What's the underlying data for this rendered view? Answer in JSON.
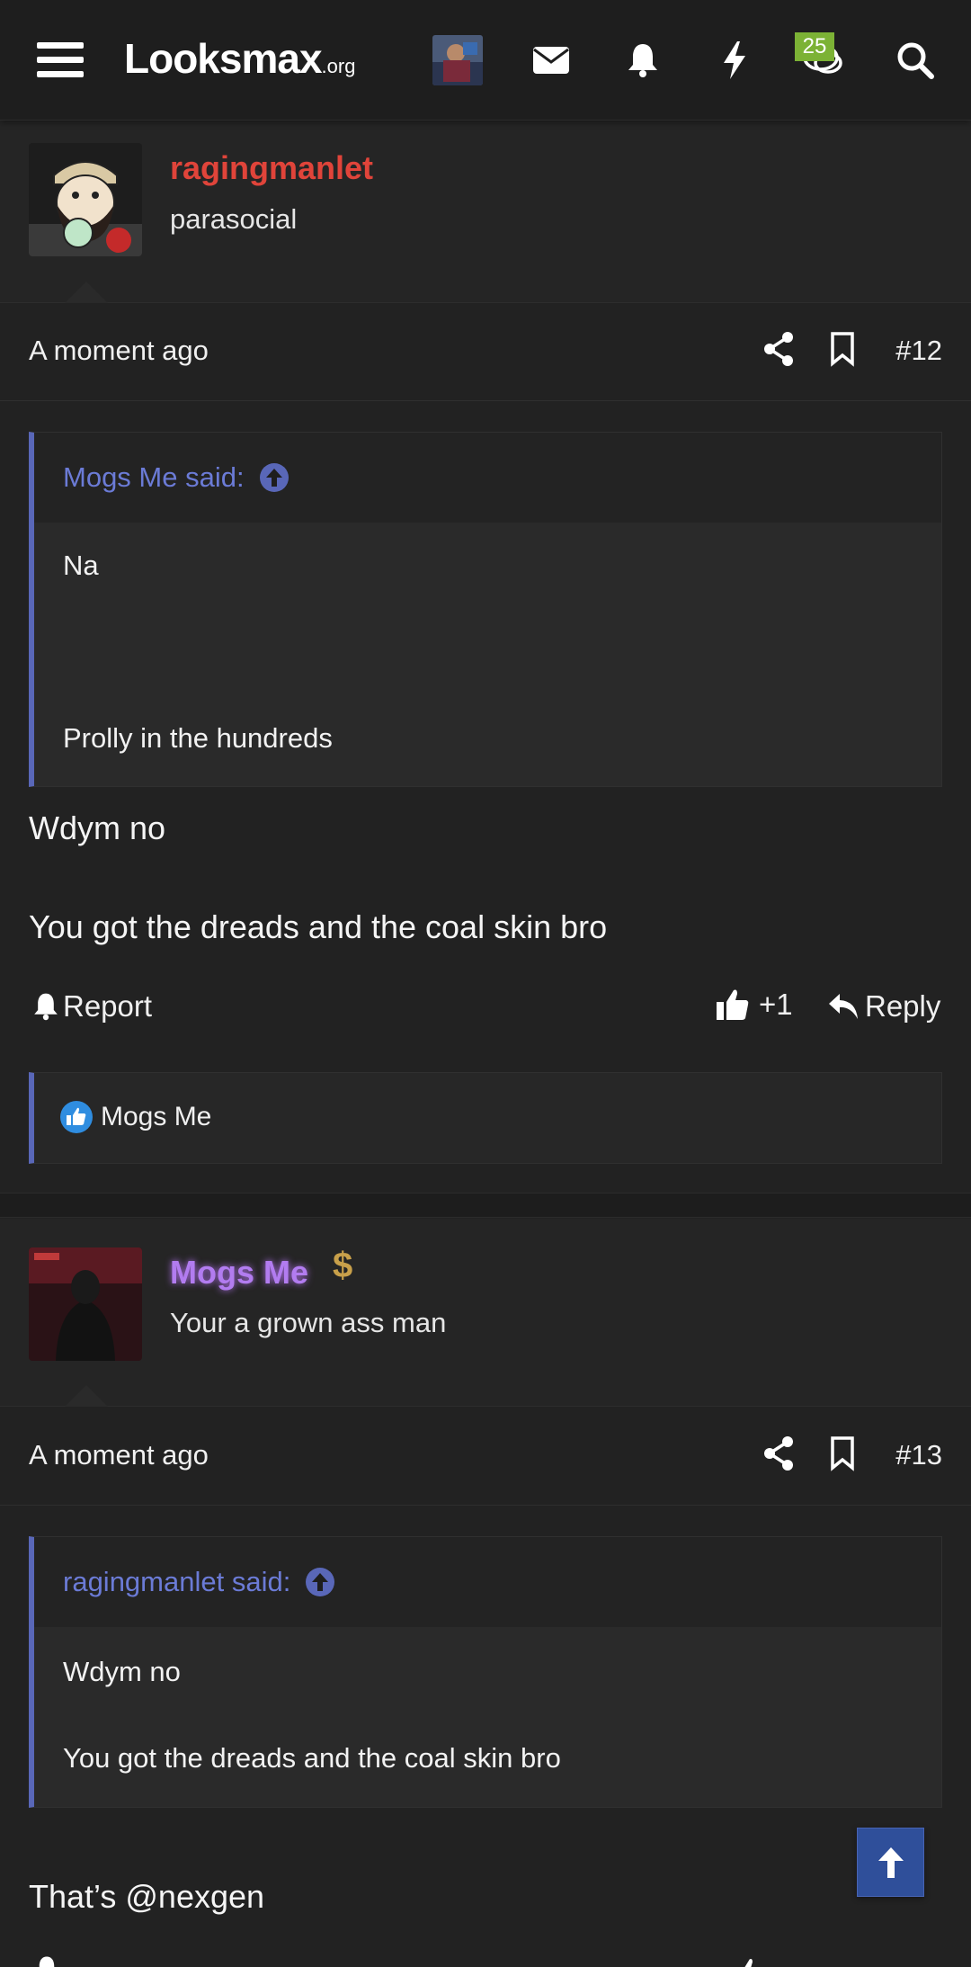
{
  "header": {
    "logo_main": "Loοksmax",
    "logo_suffix": ".org",
    "conversations_badge": "25",
    "icons": [
      "menu-icon",
      "avatar",
      "mail-icon",
      "bell-icon",
      "bolt-icon",
      "chat-icon",
      "search-icon"
    ]
  },
  "posts": [
    {
      "username": "ragingmanlet",
      "username_color": "#e0443a",
      "user_title": "parasocial",
      "time": "A moment ago",
      "number": "#12",
      "quote": {
        "attribution": "Mogs Me said:",
        "lines": [
          "Na",
          "Prolly in the hundreds"
        ]
      },
      "message": [
        "Wdym no",
        "You got the dreads and the coal skin bro"
      ],
      "actions": {
        "report": "Report",
        "like_count": "+1",
        "reply": "Reply"
      },
      "reactions": {
        "users": "Mogs Me"
      }
    },
    {
      "username": "Mogs Me",
      "username_color": "#b27cf0",
      "user_title": "Your a grown ass man",
      "time": "A moment ago",
      "number": "#13",
      "quote": {
        "attribution": "ragingmanlet said:",
        "lines": [
          "Wdym no",
          "You got the dreads and the coal skin bro"
        ]
      },
      "message": [
        "That’s @nexgen"
      ]
    }
  ],
  "accent_color": "#5967b8"
}
